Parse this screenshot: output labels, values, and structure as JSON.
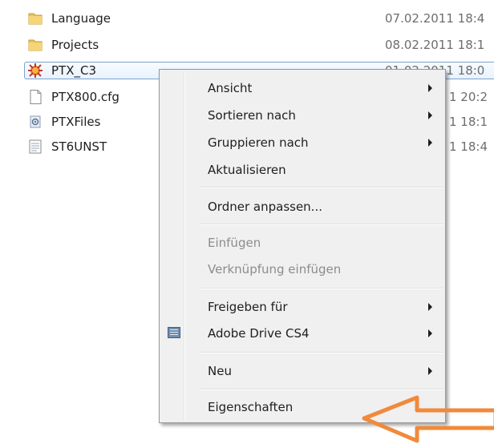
{
  "files": [
    {
      "name": "Language",
      "date": "07.02.2011 18:4",
      "icon": "folder-icon"
    },
    {
      "name": "Projects",
      "date": "08.02.2011 18:1",
      "icon": "folder-icon"
    },
    {
      "name": "PTX_C3",
      "date": "01.02.2011 18:0",
      "icon": "application-icon"
    },
    {
      "name": "PTX800.cfg",
      "date": "1 20:2",
      "icon": "file-icon"
    },
    {
      "name": "PTXFiles",
      "date": "1 18:1",
      "icon": "config-file-icon"
    },
    {
      "name": "ST6UNST",
      "date": "1 18:4",
      "icon": "text-file-icon"
    }
  ],
  "context_menu": {
    "items": [
      {
        "label": "Ansicht",
        "submenu": true,
        "enabled": true
      },
      {
        "label": "Sortieren nach",
        "submenu": true,
        "enabled": true
      },
      {
        "label": "Gruppieren nach",
        "submenu": true,
        "enabled": true
      },
      {
        "label": "Aktualisieren",
        "submenu": false,
        "enabled": true
      },
      {
        "label": "Ordner anpassen...",
        "submenu": false,
        "enabled": true
      },
      {
        "label": "Einfügen",
        "submenu": false,
        "enabled": false
      },
      {
        "label": "Verknüpfung einfügen",
        "submenu": false,
        "enabled": false
      },
      {
        "label": "Freigeben für",
        "submenu": true,
        "enabled": true
      },
      {
        "label": "Adobe Drive CS4",
        "submenu": true,
        "enabled": true,
        "icon": "adobe-drive-icon"
      },
      {
        "label": "Neu",
        "submenu": true,
        "enabled": true
      },
      {
        "label": "Eigenschaften",
        "submenu": false,
        "enabled": true
      }
    ]
  },
  "colors": {
    "menu_background": "#f0f0f0",
    "annotation_arrow": "#f08a3c",
    "selection_border": "#7da2ce"
  }
}
